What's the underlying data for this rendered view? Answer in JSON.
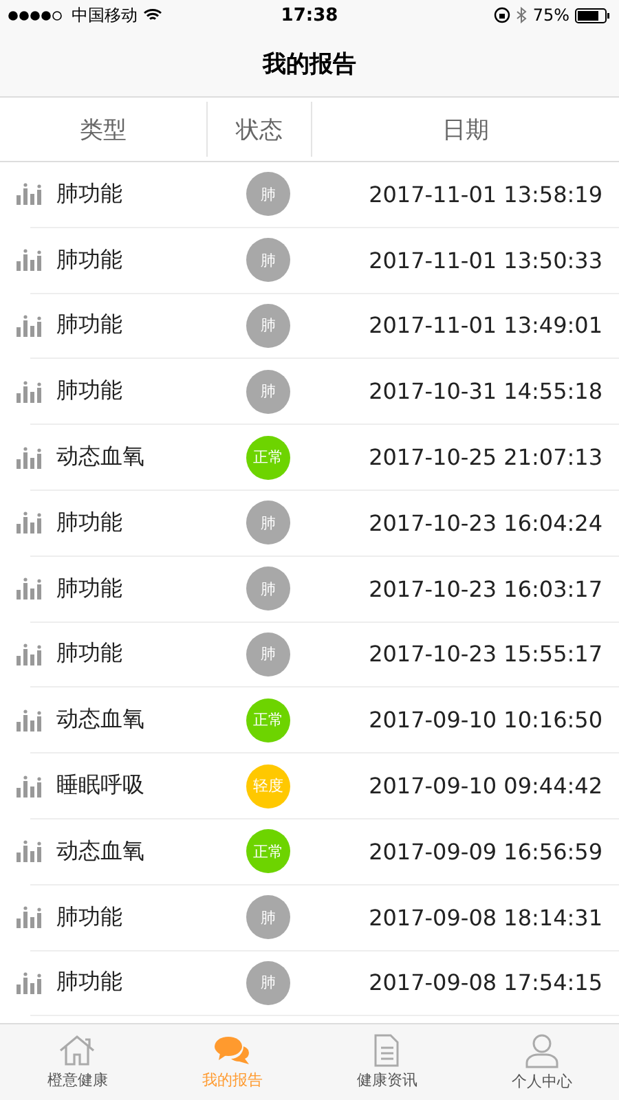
{
  "status_bar": {
    "carrier": "中国移动",
    "time": "17:38",
    "battery": "75%"
  },
  "nav": {
    "title": "我的报告"
  },
  "table": {
    "columns": [
      "类型",
      "状态",
      "日期"
    ],
    "rows": [
      {
        "type": "肺功能",
        "status": "肺",
        "color": "#a8a8a8",
        "date": "2017-11-01 13:58:19"
      },
      {
        "type": "肺功能",
        "status": "肺",
        "color": "#a8a8a8",
        "date": "2017-11-01 13:50:33"
      },
      {
        "type": "肺功能",
        "status": "肺",
        "color": "#a8a8a8",
        "date": "2017-11-01 13:49:01"
      },
      {
        "type": "肺功能",
        "status": "肺",
        "color": "#a8a8a8",
        "date": "2017-10-31 14:55:18"
      },
      {
        "type": "动态血氧",
        "status": "正常",
        "color": "#6dd400",
        "date": "2017-10-25 21:07:13"
      },
      {
        "type": "肺功能",
        "status": "肺",
        "color": "#a8a8a8",
        "date": "2017-10-23 16:04:24"
      },
      {
        "type": "肺功能",
        "status": "肺",
        "color": "#a8a8a8",
        "date": "2017-10-23 16:03:17"
      },
      {
        "type": "肺功能",
        "status": "肺",
        "color": "#a8a8a8",
        "date": "2017-10-23 15:55:17"
      },
      {
        "type": "动态血氧",
        "status": "正常",
        "color": "#6dd400",
        "date": "2017-09-10 10:16:50"
      },
      {
        "type": "睡眠呼吸",
        "status": "轻度",
        "color": "#ffc800",
        "date": "2017-09-10 09:44:42"
      },
      {
        "type": "动态血氧",
        "status": "正常",
        "color": "#6dd400",
        "date": "2017-09-09 16:56:59"
      },
      {
        "type": "肺功能",
        "status": "肺",
        "color": "#a8a8a8",
        "date": "2017-09-08 18:14:31"
      },
      {
        "type": "肺功能",
        "status": "肺",
        "color": "#a8a8a8",
        "date": "2017-09-08 17:54:15"
      }
    ]
  },
  "tab_bar": [
    {
      "label": "橙意健康",
      "kind": "home",
      "selected": false
    },
    {
      "label": "我的报告",
      "kind": "chat",
      "selected": true
    },
    {
      "label": "健康资讯",
      "kind": "doc",
      "selected": false
    },
    {
      "label": "个人中心",
      "kind": "person",
      "selected": false
    }
  ]
}
